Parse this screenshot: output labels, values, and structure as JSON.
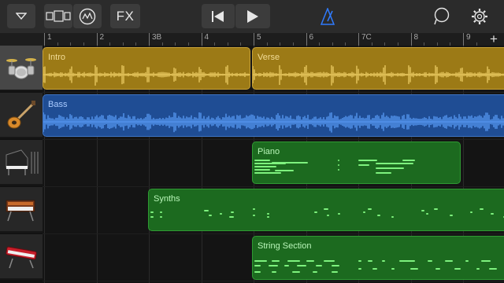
{
  "toolbar": {
    "fx_label": "FX"
  },
  "ruler": {
    "marks": [
      "1",
      "2",
      "3B",
      "4",
      "5",
      "6",
      "7C",
      "8",
      "9"
    ]
  },
  "tracks": [
    {
      "instrument": "drum-kit",
      "regions": [
        {
          "name": "Intro"
        },
        {
          "name": "Verse"
        }
      ]
    },
    {
      "instrument": "bass-guitar",
      "regions": [
        {
          "name": "Bass"
        }
      ]
    },
    {
      "instrument": "grand-piano",
      "regions": [
        {
          "name": "Piano"
        }
      ]
    },
    {
      "instrument": "synthesizer",
      "regions": [
        {
          "name": "Synths"
        }
      ]
    },
    {
      "instrument": "keyboard",
      "regions": [
        {
          "name": "String Section"
        }
      ]
    }
  ],
  "colors": {
    "audio_gold": "#9c7a16",
    "audio_blue": "#1f4d94",
    "midi_green": "#1c6a1f",
    "accent_blue": "#2f7bff"
  }
}
